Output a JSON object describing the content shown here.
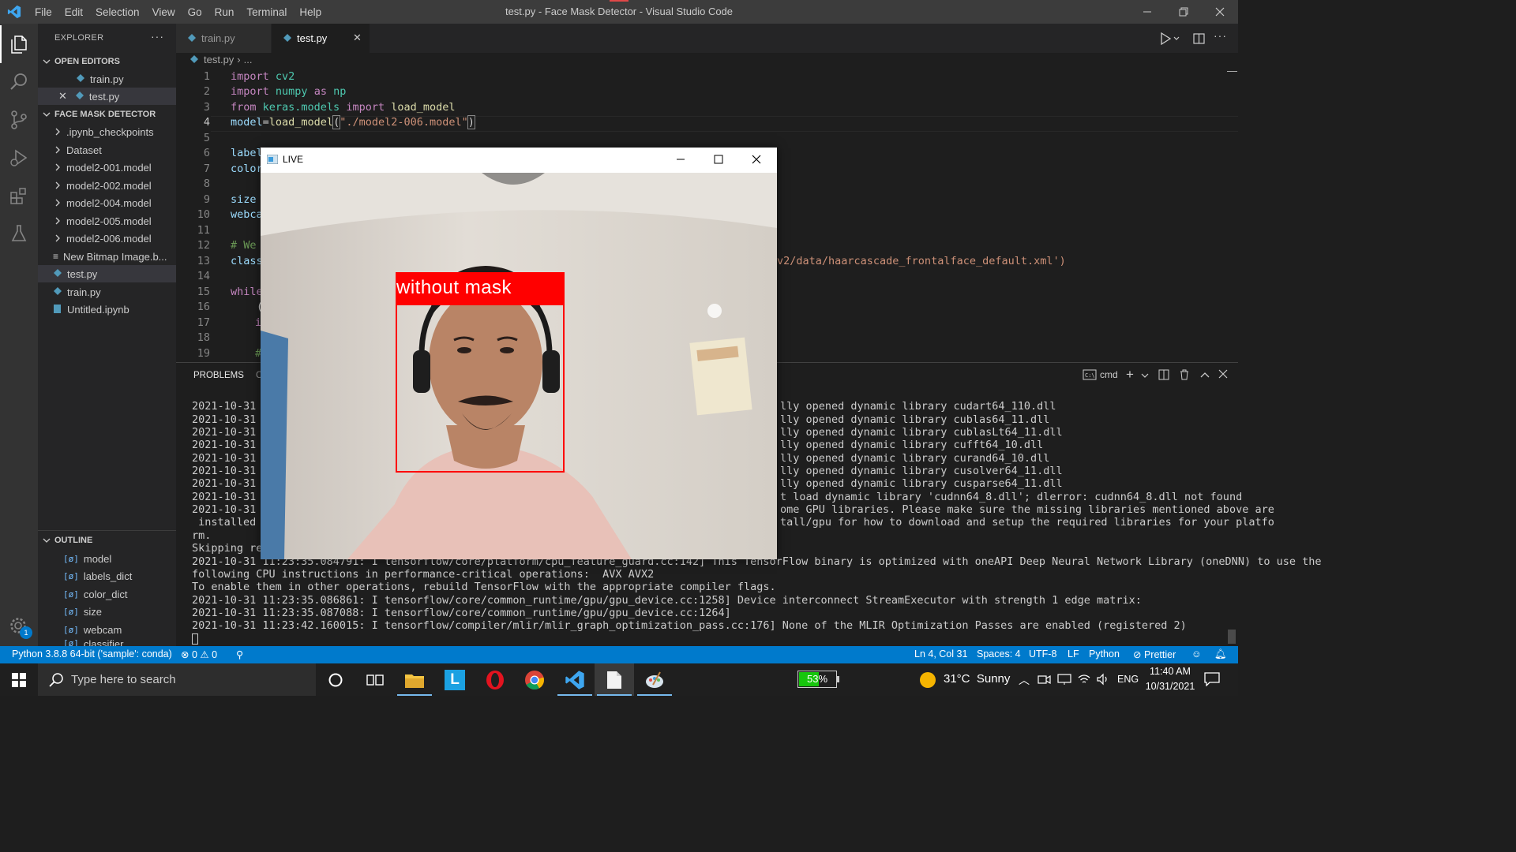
{
  "titlebar": {
    "menu": [
      "File",
      "Edit",
      "Selection",
      "View",
      "Go",
      "Run",
      "Terminal",
      "Help"
    ],
    "title": "test.py - Face Mask Detector - Visual Studio Code"
  },
  "sidebar": {
    "explorer_label": "EXPLORER",
    "open_editors_label": "OPEN EDITORS",
    "open_editors": [
      "train.py",
      "test.py"
    ],
    "project_label": "FACE MASK DETECTOR",
    "folders": [
      ".ipynb_checkpoints",
      "Dataset",
      "model2-001.model",
      "model2-002.model",
      "model2-004.model",
      "model2-005.model",
      "model2-006.model"
    ],
    "files": [
      "New Bitmap Image.b...",
      "test.py",
      "train.py",
      "Untitled.ipynb"
    ],
    "outline_label": "OUTLINE",
    "outline": [
      "model",
      "labels_dict",
      "color_dict",
      "size",
      "webcam",
      "classifier"
    ]
  },
  "tabs": [
    "train.py",
    "test.py"
  ],
  "breadcrumb": {
    "file": "test.py",
    "rest": "..."
  },
  "editor": {
    "line_numbers": [
      "1",
      "2",
      "3",
      "4",
      "5",
      "6",
      "7",
      "8",
      "9",
      "10",
      "11",
      "12",
      "13",
      "14",
      "15",
      "16",
      "17",
      "18",
      "19"
    ],
    "line1": [
      "import",
      "cv2"
    ],
    "line2": [
      "import",
      "numpy",
      "as",
      "np"
    ],
    "line3": [
      "from",
      "keras.models",
      "import",
      "load_model"
    ],
    "line4": [
      "model",
      "=",
      "load_model",
      "(",
      "\"./model2-006.model\"",
      ")"
    ],
    "line6": "label",
    "line7": "color",
    "line9": "size",
    "line10": "webca",
    "line12": "# We",
    "line13": "class",
    "line13_tail": "v2/data/haarcascade_frontalface_default.xml')",
    "line15": "while",
    "line16": "(",
    "line17": "i",
    "line19": "#"
  },
  "panel": {
    "tab_problems": "PROBLEMS",
    "tab_second": "C",
    "shell": "cmd",
    "log_left": [
      "2021-10-31 1",
      "2021-10-31 1",
      "2021-10-31 1",
      "2021-10-31 1",
      "2021-10-31 1",
      "2021-10-31 1",
      "2021-10-31 1",
      "2021-10-31 1",
      "2021-10-31 1",
      " installed p",
      "rm.",
      "Skipping reg"
    ],
    "log_right": [
      "lly opened dynamic library cudart64_110.dll",
      "lly opened dynamic library cublas64_11.dll",
      "lly opened dynamic library cublasLt64_11.dll",
      "lly opened dynamic library cufft64_10.dll",
      "lly opened dynamic library curand64_10.dll",
      "lly opened dynamic library cusolver64_11.dll",
      "lly opened dynamic library cusparse64_11.dll",
      "t load dynamic library 'cudnn64_8.dll'; dlerror: cudnn64_8.dll not found",
      "ome GPU libraries. Please make sure the missing libraries mentioned above are",
      "tall/gpu for how to download and setup the required libraries for your platfo"
    ],
    "log_full": [
      "2021-10-31 11:23:35.084791: I tensorflow/core/platform/cpu_feature_guard.cc:142] This TensorFlow binary is optimized with oneAPI Deep Neural Network Library (oneDNN) to use the",
      "following CPU instructions in performance-critical operations:  AVX AVX2",
      "To enable them in other operations, rebuild TensorFlow with the appropriate compiler flags.",
      "2021-10-31 11:23:35.086861: I tensorflow/core/common_runtime/gpu/gpu_device.cc:1258] Device interconnect StreamExecutor with strength 1 edge matrix:",
      "2021-10-31 11:23:35.087088: I tensorflow/core/common_runtime/gpu/gpu_device.cc:1264]",
      "2021-10-31 11:23:42.160015: I tensorflow/compiler/mlir/mlir_graph_optimization_pass.cc:176] None of the MLIR Optimization Passes are enabled (registered 2)"
    ]
  },
  "live_window": {
    "title": "LIVE",
    "detection_label": "without  mask"
  },
  "statusbar": {
    "interpreter": "Python 3.8.8 64-bit ('sample': conda)",
    "errors": "0",
    "warnings": "0",
    "position": "Ln 4, Col 31",
    "spaces": "Spaces: 4",
    "encoding": "UTF-8",
    "eol": "LF",
    "language": "Python",
    "formatter": "Prettier",
    "notif_count": "1"
  },
  "taskbar": {
    "search_placeholder": "Type here to search",
    "battery": "53%",
    "weather": "31°C  Sunny",
    "lang": "ENG",
    "time": "11:40 AM",
    "date": "10/31/2021"
  },
  "colors": {
    "accent": "#007acc",
    "detection_box": "#ff0000"
  }
}
